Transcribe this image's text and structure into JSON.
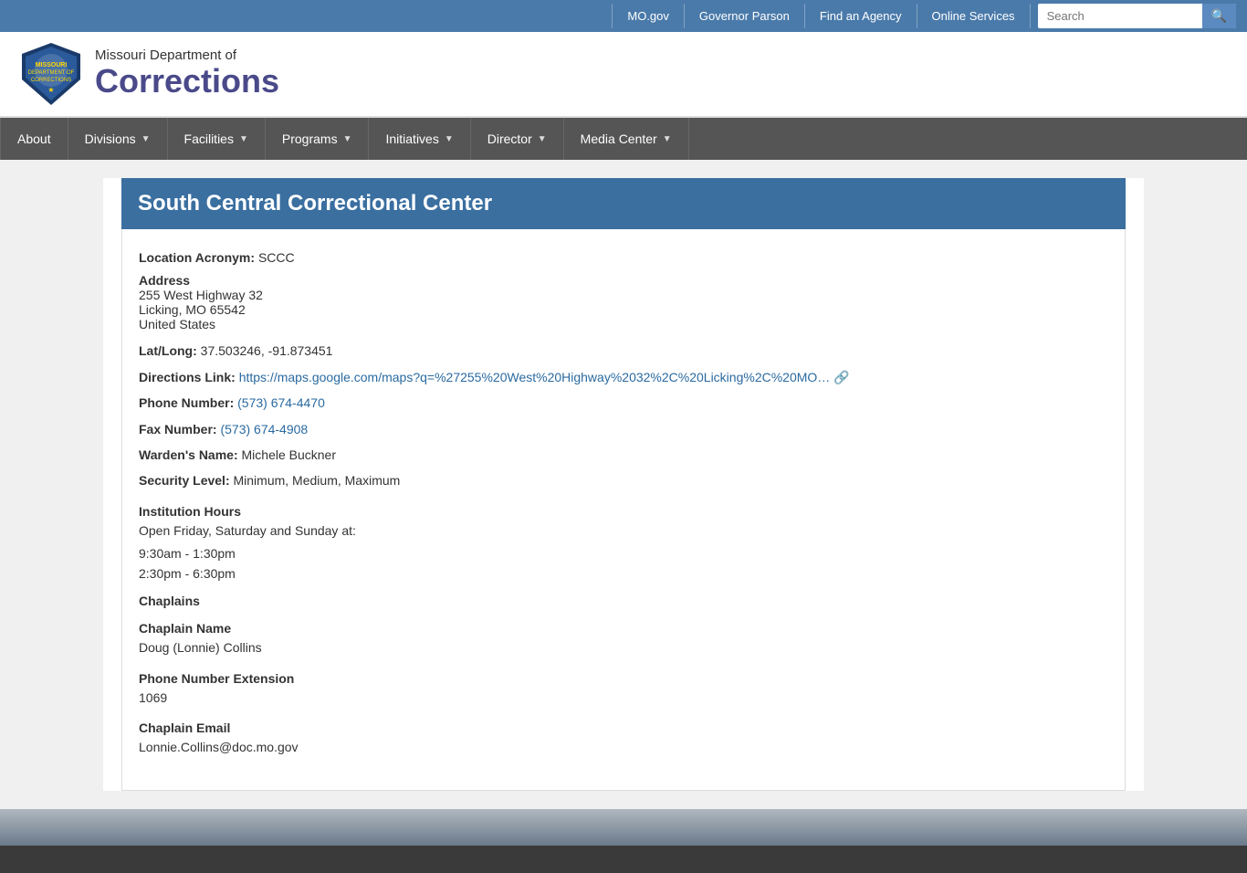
{
  "topbar": {
    "links": [
      "MO.gov",
      "Governor Parson",
      "Find an Agency",
      "Online Services"
    ],
    "search_placeholder": "Search"
  },
  "header": {
    "dept_name": "Missouri Department of",
    "org_name": "Corrections"
  },
  "nav": {
    "items": [
      {
        "label": "About",
        "has_arrow": false
      },
      {
        "label": "Divisions",
        "has_arrow": true
      },
      {
        "label": "Facilities",
        "has_arrow": true
      },
      {
        "label": "Programs",
        "has_arrow": true
      },
      {
        "label": "Initiatives",
        "has_arrow": true
      },
      {
        "label": "Director",
        "has_arrow": true
      },
      {
        "label": "Media Center",
        "has_arrow": true
      }
    ]
  },
  "facility": {
    "title": "South Central Correctional Center",
    "location_acronym_label": "Location Acronym:",
    "location_acronym_value": "SCCC",
    "address_label": "Address",
    "address_line1": "255 West Highway 32",
    "address_line2": "Licking, MO 65542",
    "address_line3": "United States",
    "latlong_label": "Lat/Long:",
    "latlong_value": "37.503246, -91.873451",
    "directions_label": "Directions Link:",
    "directions_url": "https://maps.google.com/maps?q=%27255%20West%20Highway%2032%2C%20Licking%2C%20MO...",
    "directions_text": "https://maps.google.com/maps?q=%27255%20West%20Highway%2032%2C%20Licking%2C%20MO…",
    "phone_label": "Phone Number:",
    "phone_value": "(573) 674-4470",
    "fax_label": "Fax Number:",
    "fax_value": "(573) 674-4908",
    "warden_label": "Warden's Name:",
    "warden_value": "Michele Buckner",
    "security_label": "Security Level:",
    "security_value": "Minimum, Medium, Maximum",
    "hours_heading": "Institution Hours",
    "hours_intro": "Open Friday, Saturday and Sunday at:",
    "hours_slot1": "9:30am - 1:30pm",
    "hours_slot2": "2:30pm - 6:30pm",
    "chaplains_heading": "Chaplains",
    "chaplain_name_heading": "Chaplain Name",
    "chaplain_name_value": "Doug (Lonnie) Collins",
    "chaplain_phone_ext_heading": "Phone Number Extension",
    "chaplain_phone_ext_value": "1069",
    "chaplain_email_heading": "Chaplain Email",
    "chaplain_email_value": "Lonnie.Collins@doc.mo.gov"
  }
}
